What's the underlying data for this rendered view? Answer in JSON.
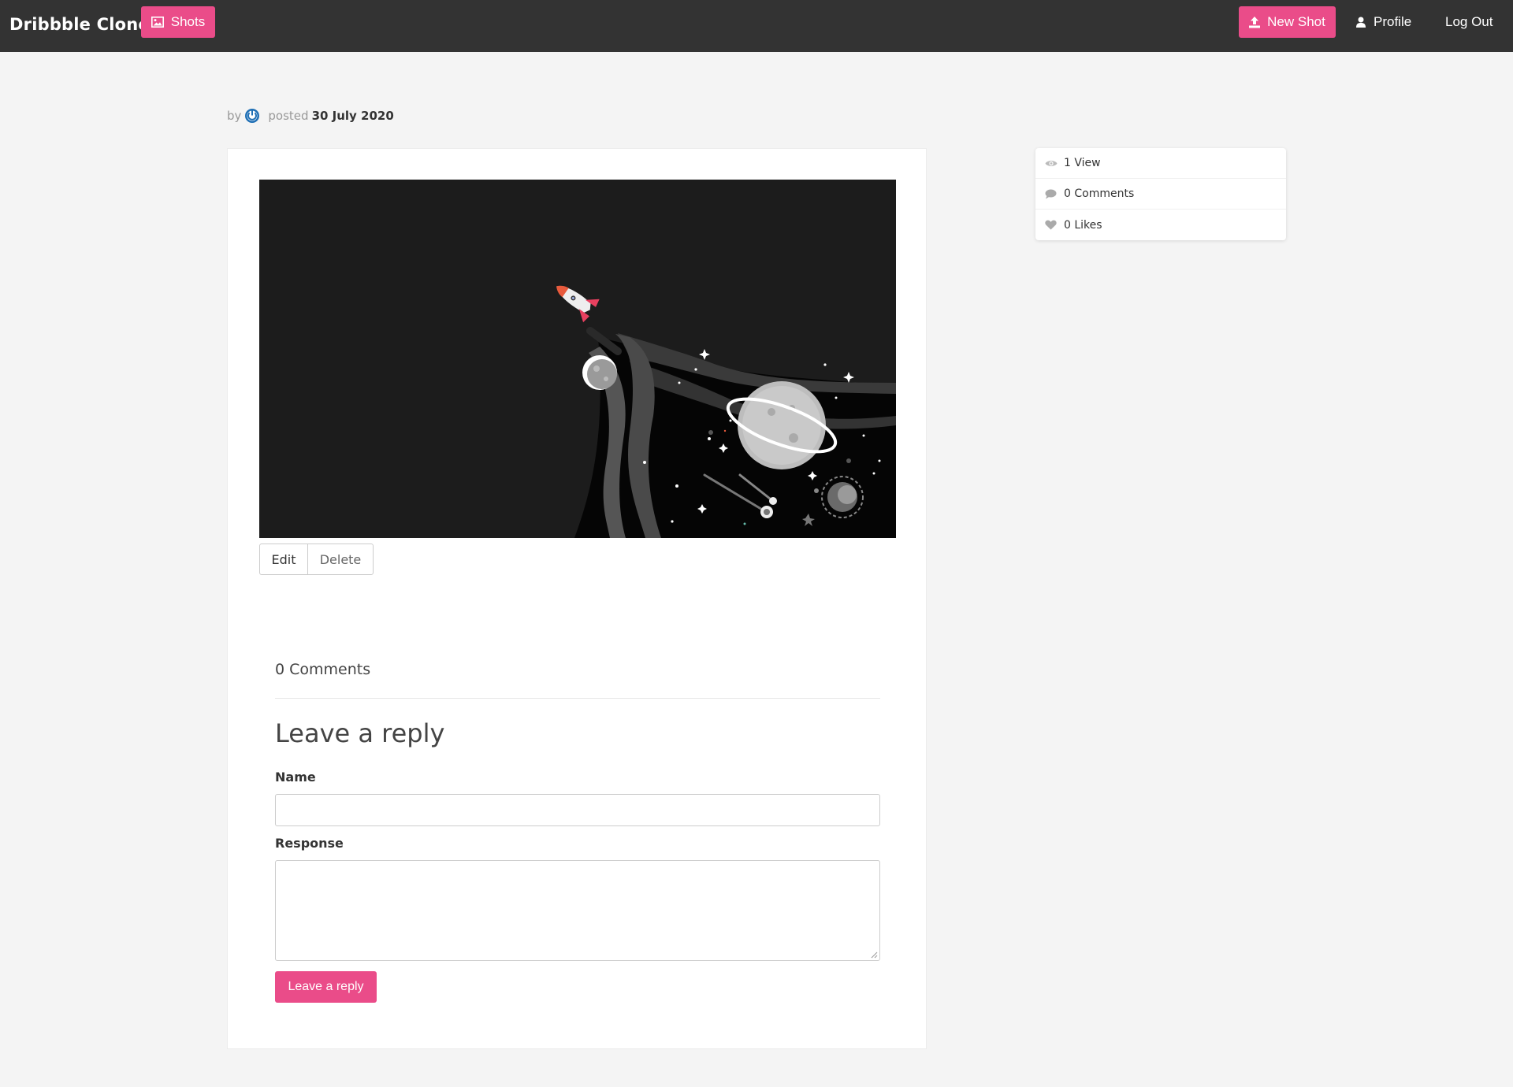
{
  "navbar": {
    "brand": "Dribbble Clone",
    "shots_label": "Shots",
    "new_shot_label": "New Shot",
    "profile_label": "Profile",
    "logout_label": "Log Out"
  },
  "shot": {
    "by_label": "by",
    "posted_label": "posted",
    "date": "30 July 2020",
    "edit_label": "Edit",
    "delete_label": "Delete"
  },
  "comments": {
    "count_label": "0 Comments"
  },
  "reply_form": {
    "title": "Leave a reply",
    "name_label": "Name",
    "response_label": "Response",
    "submit_label": "Leave a reply"
  },
  "stats": {
    "views": "1 View",
    "comments": "0 Comments",
    "likes": "0 Likes"
  },
  "colors": {
    "accent": "#ea4c89",
    "navbar": "#333333",
    "background": "#f4f4f4"
  }
}
